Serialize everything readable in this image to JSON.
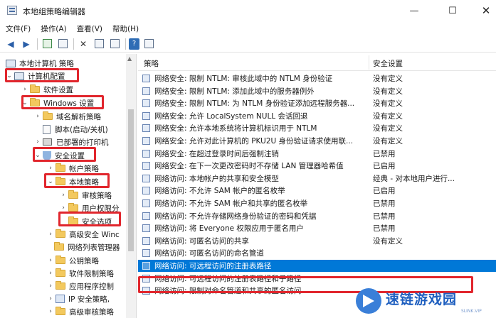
{
  "window": {
    "title": "本地组策略编辑器",
    "minimize": "—",
    "maximize": "☐",
    "close": "✕"
  },
  "menu": [
    "文件(F)",
    "操作(A)",
    "查看(V)",
    "帮助(H)"
  ],
  "toolbar": {
    "back_icon": "arrow-left-icon",
    "forward_icon": "arrow-right-icon",
    "delete_icon": "x-icon",
    "help_icon": "help-icon",
    "help_label": "?"
  },
  "tree": {
    "root": "本地计算机 策略",
    "items": [
      {
        "label": "计算机配置",
        "level": 0
      },
      {
        "label": "软件设置",
        "level": 1
      },
      {
        "label": "Windows 设置",
        "level": 1
      },
      {
        "label": "域名解析策略",
        "level": 2
      },
      {
        "label": "脚本(启动/关机)",
        "level": 2
      },
      {
        "label": "已部署的打印机",
        "level": 2
      },
      {
        "label": "安全设置",
        "level": 2
      },
      {
        "label": "帐户策略",
        "level": 3
      },
      {
        "label": "本地策略",
        "level": 3
      },
      {
        "label": "审核策略",
        "level": 4
      },
      {
        "label": "用户权限分",
        "level": 4
      },
      {
        "label": "安全选项",
        "level": 4
      },
      {
        "label": "高级安全 Winc",
        "level": 3
      },
      {
        "label": "网络列表管理器",
        "level": 3
      },
      {
        "label": "公钥策略",
        "level": 3
      },
      {
        "label": "软件限制策略",
        "level": 3
      },
      {
        "label": "应用程序控制",
        "level": 3
      },
      {
        "label": "IP 安全策略,",
        "level": 3
      },
      {
        "label": "高级审核策略",
        "level": 3
      }
    ]
  },
  "columns": {
    "policy": "策略",
    "setting": "安全设置"
  },
  "policies": [
    {
      "name": "网络安全: 限制 NTLM: 审核此域中的 NTLM 身份验证",
      "setting": "没有定义"
    },
    {
      "name": "网络安全: 限制 NTLM: 添加此域中的服务器例外",
      "setting": "没有定义"
    },
    {
      "name": "网络安全: 限制 NTLM: 为 NTLM 身份验证添加远程服务器...",
      "setting": "没有定义"
    },
    {
      "name": "网络安全: 允许 LocalSystem NULL 会话回退",
      "setting": "没有定义"
    },
    {
      "name": "网络安全: 允许本地系统将计算机标识用于 NTLM",
      "setting": "没有定义"
    },
    {
      "name": "网络安全: 允许对此计算机的 PKU2U 身份验证请求使用联...",
      "setting": "没有定义"
    },
    {
      "name": "网络安全: 在超过登录时间后强制注销",
      "setting": "已禁用"
    },
    {
      "name": "网络安全: 在下一次更改密码时不存储 LAN 管理器哈希值",
      "setting": "已启用"
    },
    {
      "name": "网络访问: 本地帐户的共享和安全模型",
      "setting": "经典 - 对本地用户进行..."
    },
    {
      "name": "网络访问: 不允许 SAM 帐户的匿名枚举",
      "setting": "已启用"
    },
    {
      "name": "网络访问: 不允许 SAM 帐户和共享的匿名枚举",
      "setting": "已禁用"
    },
    {
      "name": "网络访问: 不允许存储网络身份验证的密码和凭据",
      "setting": "已禁用"
    },
    {
      "name": "网络访问: 将 Everyone 权限应用于匿名用户",
      "setting": "已禁用"
    },
    {
      "name": "网络访问: 可匿名访问的共享",
      "setting": "没有定义"
    },
    {
      "name": "网络访问: 可匿名访问的命名管道",
      "setting": ""
    },
    {
      "name": "网络访问: 可远程访问的注册表路径",
      "setting": "",
      "selected": true
    },
    {
      "name": "网络访问: 可远程访问的注册表路径和子路径",
      "setting": ""
    },
    {
      "name": "网络访问: 限制对命名管道和共享的匿名访问",
      "setting": ""
    }
  ],
  "watermark": {
    "text": "速链游戏园",
    "sub": "SLINK.VIP"
  },
  "colors": {
    "highlight_red": "#e1262d",
    "selection_blue": "#0078d7",
    "folder_yellow": "#f3c95e"
  }
}
